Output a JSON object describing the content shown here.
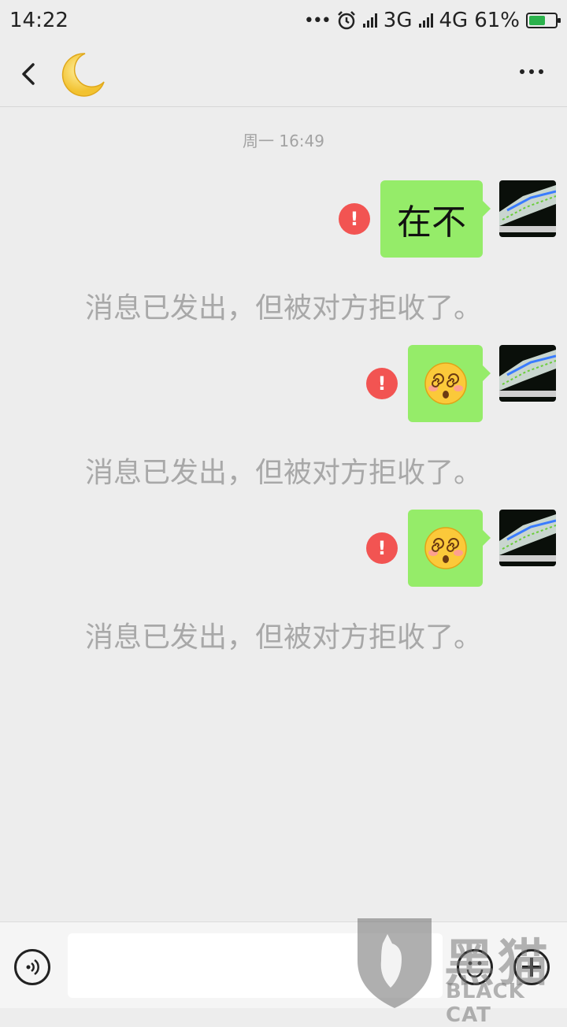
{
  "status_bar": {
    "time": "14:22",
    "dots": "•••",
    "network_1": "3G",
    "network_2": "4G",
    "battery_percent": "61%",
    "battery_level": 0.61,
    "icons": [
      "alarm-icon",
      "signal-icon",
      "battery-charging-icon"
    ]
  },
  "nav": {
    "back_icon": "chevron-left-icon",
    "contact_avatar": "crescent-moon-emoji",
    "more_icon": "more-dots-icon"
  },
  "chat": {
    "timestamp": "周一 16:49",
    "messages": [
      {
        "type": "text",
        "text": "在不",
        "status": "failed",
        "notice": "消息已发出，但被对方拒收了。"
      },
      {
        "type": "emoji",
        "emoji": "dizzy-face-emoji",
        "status": "failed",
        "notice": "消息已发出，但被对方拒收了。"
      },
      {
        "type": "emoji",
        "emoji": "dizzy-face-emoji",
        "status": "failed",
        "notice": "消息已发出，但被对方拒收了。"
      }
    ]
  },
  "input_bar": {
    "voice_icon": "voice-icon",
    "input_value": "",
    "emoji_icon": "smiley-icon",
    "plus_icon": "plus-icon"
  },
  "watermark": {
    "text_cn": "黑猫",
    "text_en": "BLACK CAT",
    "logo": "black-cat-logo"
  },
  "colors": {
    "background": "#ededed",
    "bubble": "#95ec69",
    "error": "#f25452",
    "notice_text": "#a8a8a8"
  }
}
